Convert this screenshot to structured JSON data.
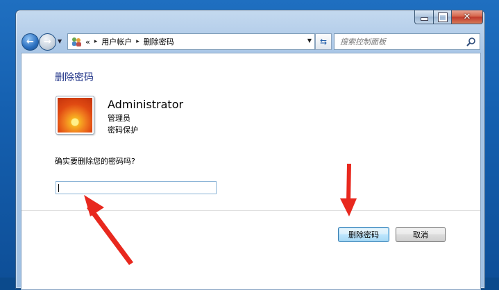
{
  "nav": {
    "breadcrumb_overflow": "«",
    "breadcrumb": [
      "用户帐户",
      "删除密码"
    ],
    "separator": "▸",
    "search_placeholder": "搜索控制面板"
  },
  "page": {
    "title": "删除密码",
    "account_name": "Administrator",
    "account_type": "管理员",
    "account_status": "密码保护",
    "question": "确实要删除您的密码吗?",
    "password_value": ""
  },
  "buttons": {
    "delete_label": "删除密码",
    "cancel_label": "取消"
  },
  "annotation_color": "#e8281e"
}
